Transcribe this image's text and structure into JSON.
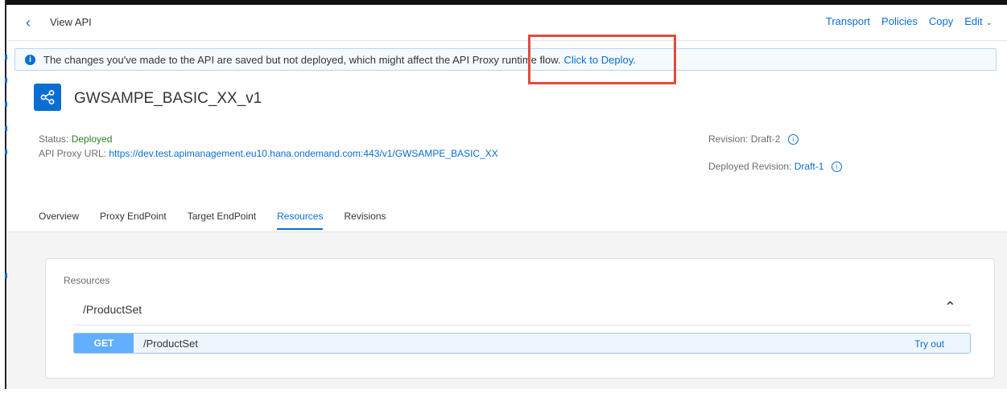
{
  "header": {
    "back_icon": "chevron-left-icon",
    "title": "View API",
    "actions": {
      "transport": "Transport",
      "policies": "Policies",
      "copy": "Copy",
      "edit": "Edit"
    }
  },
  "banner": {
    "icon": "info-icon",
    "message": "The changes you've made to the API are saved but not deployed, which might affect the API Proxy runtime flow.",
    "link": "Click to Deploy.",
    "annotation_color": "#e04c3f"
  },
  "api": {
    "icon": "share-icon",
    "name": "GWSAMPE_BASIC_XX_v1",
    "status_label": "Status:",
    "status_value": "Deployed",
    "proxy_url_label": "API Proxy URL:",
    "proxy_url": "https://dev.test.apimanagement.eu10.hana.ondemand.com:443/v1/GWSAMPE_BASIC_XX",
    "revision_label": "Revision:",
    "revision_value": "Draft-2",
    "deployed_revision_label": "Deployed Revision:",
    "deployed_revision_value": "Draft-1"
  },
  "tabs": [
    {
      "label": "Overview"
    },
    {
      "label": "Proxy EndPoint"
    },
    {
      "label": "Target EndPoint"
    },
    {
      "label": "Resources"
    },
    {
      "label": "Revisions"
    }
  ],
  "active_tab": "Resources",
  "resources": {
    "title": "Resources",
    "group": "/ProductSet",
    "operation": {
      "method": "GET",
      "path": "/ProductSet",
      "action": "Try out"
    }
  },
  "colors": {
    "accent": "#0a6ed1",
    "status_ok": "#2b7d2b",
    "get_verb": "#61affe"
  }
}
